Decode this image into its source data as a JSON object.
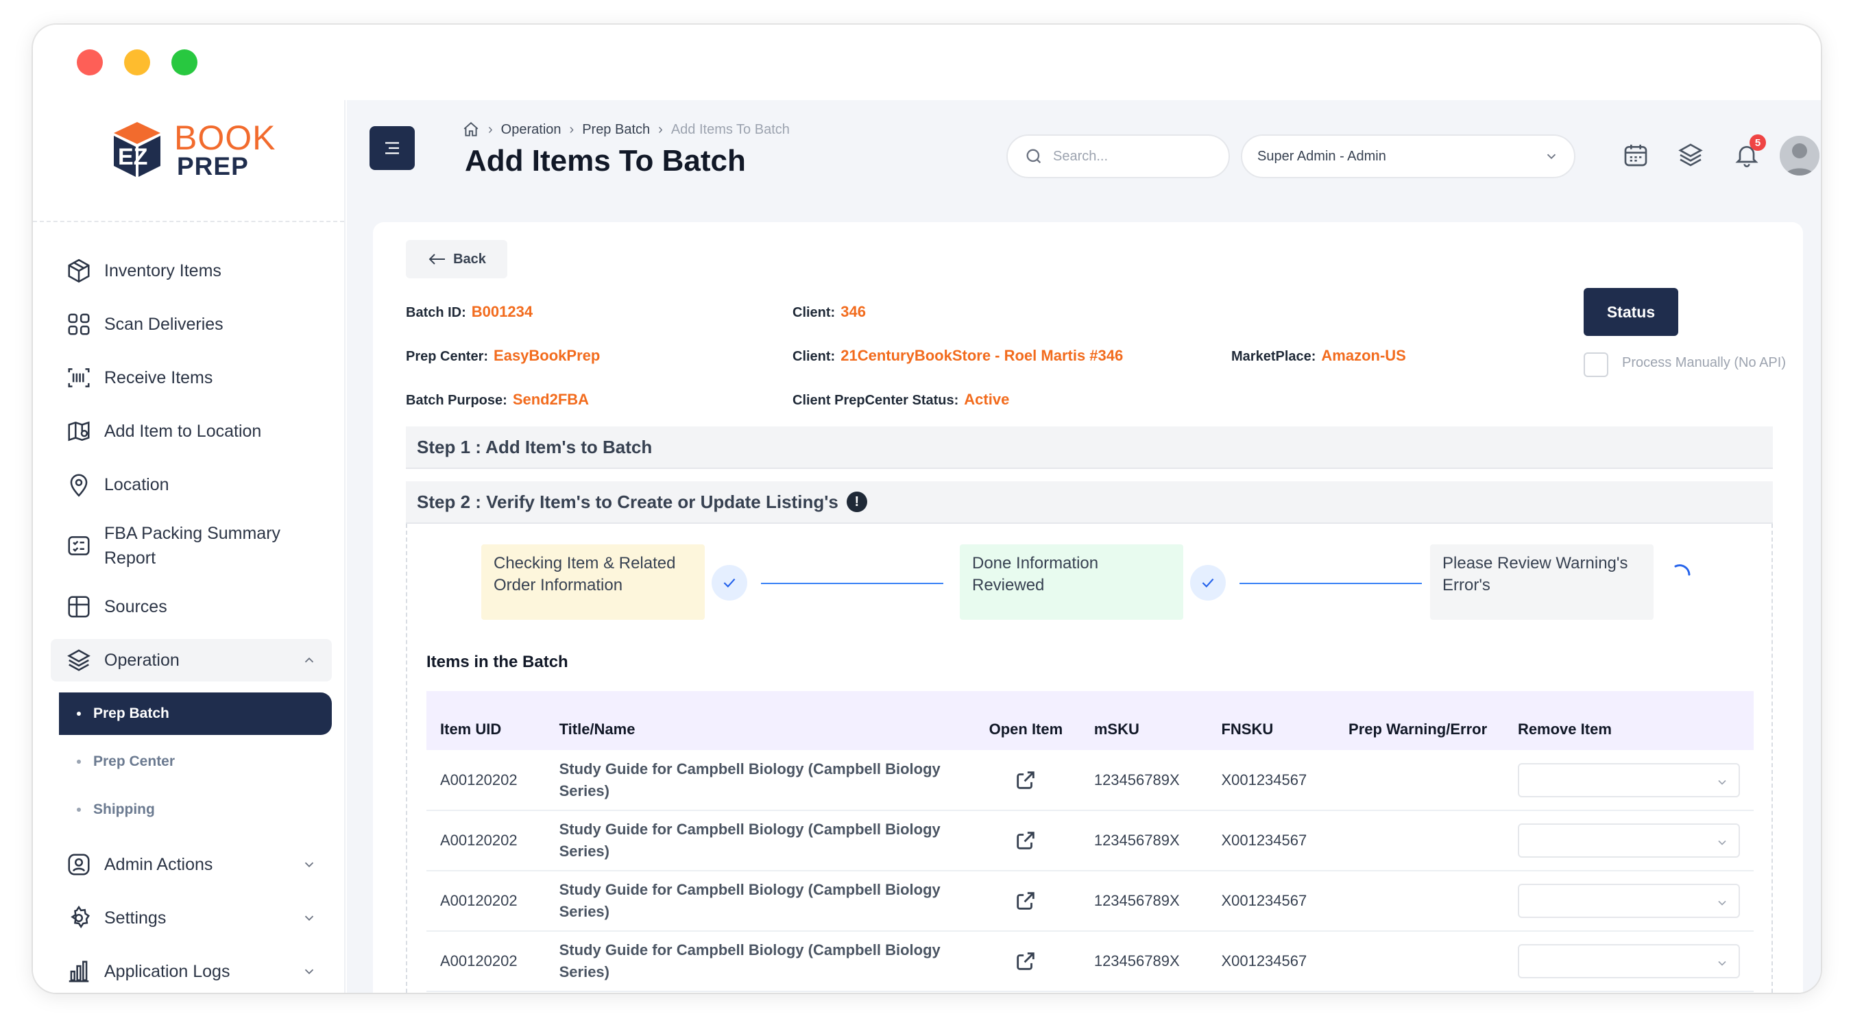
{
  "app": {
    "logo_top": "BOOK",
    "logo_bottom": "PREP"
  },
  "sidebar": {
    "items": [
      {
        "label": "Inventory Items",
        "icon": "box-icon"
      },
      {
        "label": "Scan Deliveries",
        "icon": "scan-icon"
      },
      {
        "label": "Receive Items",
        "icon": "barcode-icon"
      },
      {
        "label": "Add Item to Location",
        "icon": "map-pin-icon"
      },
      {
        "label": "Location",
        "icon": "location-icon"
      },
      {
        "label": "FBA Packing Summary Report",
        "icon": "report-icon"
      },
      {
        "label": "Sources",
        "icon": "grid-icon"
      },
      {
        "label": "Operation",
        "icon": "layers-icon"
      },
      {
        "label": "Admin Actions",
        "icon": "user-icon"
      },
      {
        "label": "Settings",
        "icon": "gear-icon"
      },
      {
        "label": "Application Logs",
        "icon": "bar-chart-icon"
      }
    ],
    "operation_sub": [
      "Prep Batch",
      "Prep Center",
      "Shipping"
    ]
  },
  "header": {
    "breadcrumb": [
      "Operation",
      "Prep Batch",
      "Add Items To Batch"
    ],
    "title": "Add Items To Batch",
    "search_placeholder": "Search...",
    "role": "Super Admin - Admin",
    "notification_count": "5"
  },
  "batch": {
    "back_label": "Back",
    "batch_id_label": "Batch ID:",
    "batch_id": "B001234",
    "client_label": "Client:",
    "client_id": "346",
    "prep_center_label": "Prep Center:",
    "prep_center": "EasyBookPrep",
    "client2_label": "Client:",
    "client_name": "21CenturyBookStore - Roel Martis #346",
    "marketplace_label": "MarketPlace:",
    "marketplace": "Amazon-US",
    "purpose_label": "Batch Purpose:",
    "purpose": "Send2FBA",
    "cp_status_label": "Client PrepCenter Status:",
    "cp_status": "Active",
    "status_button": "Status",
    "process_manually": "Process Manually (No API)"
  },
  "steps": {
    "step1": "Step 1 : Add Item's to Batch",
    "step2": "Step 2 : Verify Item's to Create or Update Listing's",
    "progress": [
      {
        "label": "Checking Item & Related Order Information",
        "color": "#fdf6dc"
      },
      {
        "label": "Done Information Reviewed",
        "color": "#e8fbef"
      },
      {
        "label": "Please Review Warning's Error's",
        "color": "#f4f5f6"
      }
    ]
  },
  "table": {
    "title": "Items in the Batch",
    "columns": [
      "Item UID",
      "Title/Name",
      "Open Item",
      "mSKU",
      "FNSKU",
      "Prep Warning/Error",
      "Remove Item"
    ],
    "rows": [
      {
        "uid": "A00120202",
        "title": "Study Guide for Campbell Biology (Campbell Biology Series)",
        "msku": "123456789X",
        "fnsku": "X001234567",
        "warning": ""
      },
      {
        "uid": "A00120202",
        "title": "Study Guide for Campbell Biology (Campbell Biology Series)",
        "msku": "123456789X",
        "fnsku": "X001234567",
        "warning": ""
      },
      {
        "uid": "A00120202",
        "title": "Study Guide for Campbell Biology (Campbell Biology Series)",
        "msku": "123456789X",
        "fnsku": "X001234567",
        "warning": ""
      },
      {
        "uid": "A00120202",
        "title": "Study Guide for Campbell Biology (Campbell Biology Series)",
        "msku": "123456789X",
        "fnsku": "X001234567",
        "warning": ""
      }
    ]
  }
}
